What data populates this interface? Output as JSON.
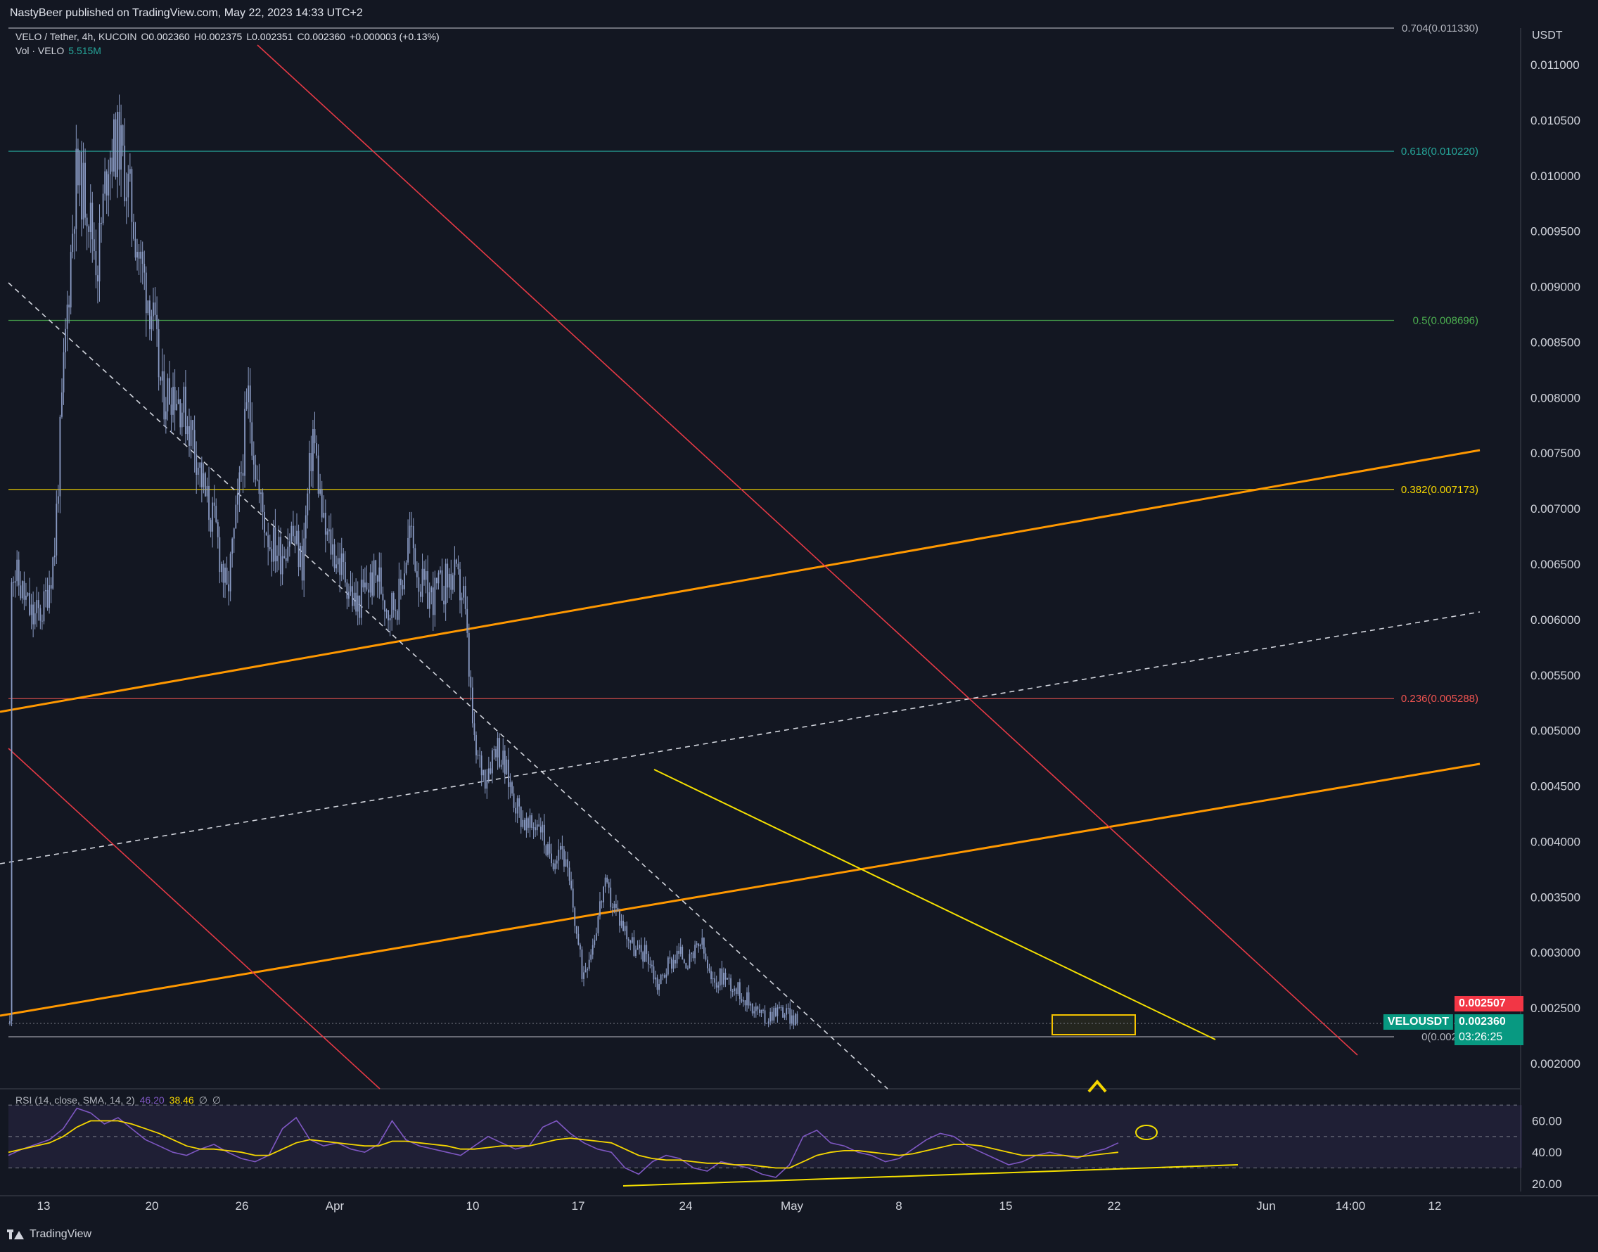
{
  "header": {
    "publisher_line": "NastyBeer published on TradingView.com, May 22, 2023 14:33 UTC+2"
  },
  "legend": {
    "symbol": "VELO / Tether, 4h, KUCOIN",
    "open_label": "O",
    "open": "0.002360",
    "high_label": "H",
    "high": "0.002375",
    "low_label": "L",
    "low": "0.002351",
    "close_label": "C",
    "close": "0.002360",
    "change": "+0.000003 (+0.13%)",
    "vol_label": "Vol · VELO",
    "vol_value": "5.515M"
  },
  "rsi_legend": {
    "label": "RSI (14, close, SMA, 14, 2)",
    "value1": "46.20",
    "value2": "38.46",
    "extra1": "∅",
    "extra2": "∅"
  },
  "footer": {
    "brand": "TradingView"
  },
  "colors": {
    "background": "#131722",
    "up_candle": "#26a69a",
    "candle": "#8a9bc4",
    "fib_0704": "#b2b5be",
    "fib_0618": "#26a69a",
    "fib_05": "#4caf50",
    "fib_0382": "#f5d600",
    "fib_0236": "#ef5350",
    "fib_0": "#b2b5be",
    "channel_orange": "#ff9800",
    "red_line": "#e53945",
    "yellow_trend": "#f5e000",
    "rsi_line": "#7e57c2",
    "rsi_ma": "#f5d600",
    "last_price_badge": "#089981",
    "red_badge": "#f23645"
  },
  "chart_data": [
    {
      "type": "candlestick",
      "title": "VELO / Tether, 4h, KUCOIN",
      "y_unit": "USDT",
      "ylim": [
        0.00185,
        0.0114
      ],
      "y_ticks": [
        "0.011000",
        "0.010500",
        "0.010000",
        "0.009500",
        "0.009000",
        "0.008500",
        "0.008000",
        "0.007500",
        "0.007000",
        "0.006500",
        "0.006000",
        "0.005500",
        "0.005000",
        "0.004500",
        "0.004000",
        "0.003500",
        "0.003000",
        "0.002500",
        "0.002000"
      ],
      "x_tick_labels": [
        "13",
        "20",
        "26",
        "Apr",
        "10",
        "17",
        "24",
        "May",
        "8",
        "15",
        "22",
        "Jun",
        "14:00",
        "12"
      ],
      "price_path": [
        [
          "Mar 10",
          0.0065
        ],
        [
          "Mar 12",
          0.006
        ],
        [
          "Mar 13",
          0.0061
        ],
        [
          "Mar 14",
          0.0066
        ],
        [
          "Mar 15",
          0.0085
        ],
        [
          "Mar 16",
          0.01
        ],
        [
          "Mar 17",
          0.0098
        ],
        [
          "Mar 18",
          0.0092
        ],
        [
          "Mar 19",
          0.0102
        ],
        [
          "Mar 20",
          0.0103
        ],
        [
          "Mar 21",
          0.0098
        ],
        [
          "Mar 22",
          0.0092
        ],
        [
          "Mar 23",
          0.0088
        ],
        [
          "Mar 24",
          0.008
        ],
        [
          "Mar 25",
          0.0081
        ],
        [
          "Mar 26",
          0.0079
        ],
        [
          "Mar 27",
          0.0076
        ],
        [
          "Mar 28",
          0.0071
        ],
        [
          "Mar 29",
          0.0068
        ],
        [
          "Mar 30",
          0.0062
        ],
        [
          "Mar 31",
          0.007
        ],
        [
          "Apr 1",
          0.008
        ],
        [
          "Apr 2",
          0.0071
        ],
        [
          "Apr 3",
          0.0067
        ],
        [
          "Apr 4",
          0.0066
        ],
        [
          "Apr 5",
          0.0068
        ],
        [
          "Apr 6",
          0.0065
        ],
        [
          "Apr 7",
          0.0077
        ],
        [
          "Apr 8",
          0.0068
        ],
        [
          "Apr 9",
          0.0066
        ],
        [
          "Apr 10",
          0.0064
        ],
        [
          "Apr 11",
          0.0061
        ],
        [
          "Apr 12",
          0.0063
        ],
        [
          "Apr 13",
          0.0064
        ],
        [
          "Apr 14",
          0.0061
        ],
        [
          "Apr 15",
          0.0062
        ],
        [
          "Apr 16",
          0.0068
        ],
        [
          "Apr 17",
          0.0063
        ],
        [
          "Apr 18",
          0.0062
        ],
        [
          "Apr 19",
          0.0063
        ],
        [
          "Apr 20",
          0.0064
        ],
        [
          "Apr 21",
          0.0062
        ],
        [
          "Apr 22",
          0.0048
        ],
        [
          "Apr 23",
          0.0046
        ],
        [
          "Apr 24",
          0.0049
        ],
        [
          "Apr 25",
          0.0046
        ],
        [
          "Apr 26",
          0.0043
        ],
        [
          "Apr 27",
          0.0041
        ],
        [
          "Apr 28",
          0.0042
        ],
        [
          "Apr 29",
          0.0038
        ],
        [
          "Apr 30",
          0.004
        ],
        [
          "May 1",
          0.0035
        ],
        [
          "May 2",
          0.0028
        ],
        [
          "May 3",
          0.0031
        ],
        [
          "May 4",
          0.0036
        ],
        [
          "May 5",
          0.0034
        ],
        [
          "May 6",
          0.0032
        ],
        [
          "May 7",
          0.003
        ],
        [
          "May 8",
          0.003
        ],
        [
          "May 9",
          0.0027
        ],
        [
          "May 10",
          0.0029
        ],
        [
          "May 11",
          0.003
        ],
        [
          "May 12",
          0.0029
        ],
        [
          "May 13",
          0.0031
        ],
        [
          "May 14",
          0.0027
        ],
        [
          "May 15",
          0.0028
        ],
        [
          "May 16",
          0.0027
        ],
        [
          "May 17",
          0.0026
        ],
        [
          "May 18",
          0.0025
        ],
        [
          "May 19",
          0.0024
        ],
        [
          "May 20",
          0.0025
        ],
        [
          "May 21",
          0.00245
        ],
        [
          "May 22",
          0.00236
        ]
      ],
      "fib_levels": [
        {
          "label": "0.704(0.011330)",
          "value": 0.01133
        },
        {
          "label": "0.618(0.010220)",
          "value": 0.01022
        },
        {
          "label": "0.5(0.008696)",
          "value": 0.008696
        },
        {
          "label": "0.382(0.007173)",
          "value": 0.007173
        },
        {
          "label": "0.236(0.005288)",
          "value": 0.005288
        },
        {
          "label": "0(0.002241)",
          "value": 0.002241
        }
      ],
      "price_labels": {
        "red_level": "0.002507",
        "ticker": "VELOUSDT",
        "last_price": "0.002360",
        "countdown": "03:26:25"
      }
    },
    {
      "type": "line",
      "title": "RSI (14, close, SMA, 14, 2)",
      "ylim": [
        15,
        75
      ],
      "y_ticks": [
        "60.00",
        "40.00",
        "20.00"
      ],
      "bands": [
        70,
        50,
        30
      ],
      "series": [
        {
          "name": "RSI",
          "values": [
            38,
            42,
            45,
            48,
            55,
            68,
            65,
            58,
            62,
            55,
            48,
            44,
            40,
            38,
            42,
            45,
            40,
            36,
            34,
            38,
            55,
            62,
            48,
            44,
            46,
            42,
            40,
            45,
            60,
            48,
            44,
            42,
            40,
            38,
            44,
            50,
            46,
            42,
            44,
            56,
            60,
            52,
            46,
            42,
            40,
            30,
            26,
            34,
            38,
            36,
            30,
            28,
            34,
            32,
            30,
            26,
            24,
            32,
            50,
            54,
            46,
            44,
            40,
            38,
            34,
            36,
            42,
            48,
            52,
            50,
            44,
            40,
            36,
            32,
            34,
            38,
            40,
            38,
            36,
            40,
            42,
            46
          ]
        },
        {
          "name": "SMA",
          "values": [
            40,
            42,
            44,
            46,
            50,
            56,
            60,
            60,
            60,
            58,
            55,
            52,
            48,
            44,
            42,
            42,
            41,
            40,
            38,
            38,
            42,
            46,
            48,
            47,
            46,
            45,
            44,
            44,
            47,
            47,
            46,
            45,
            44,
            42,
            42,
            43,
            44,
            44,
            44,
            46,
            48,
            49,
            48,
            47,
            46,
            42,
            38,
            36,
            35,
            35,
            34,
            33,
            33,
            32,
            32,
            31,
            30,
            30,
            34,
            38,
            40,
            41,
            41,
            40,
            39,
            38,
            39,
            41,
            43,
            45,
            45,
            44,
            42,
            40,
            38,
            38,
            38,
            38,
            37,
            38,
            39,
            40
          ]
        }
      ]
    }
  ]
}
